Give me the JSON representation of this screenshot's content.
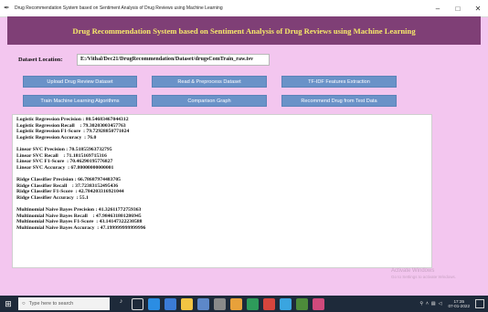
{
  "window": {
    "title": "Drug Recommendation System based on Sentiment Analysis of Drug Reviews using Machine Learning",
    "controls": {
      "minimize": "–",
      "maximize": "□",
      "close": "✕"
    }
  },
  "header": {
    "title": "Drug Recommendation System based on Sentiment Analysis of Drug Reviews using Machine Learning"
  },
  "dataset": {
    "label": "Dataset Location:",
    "path": "E:/Vithal/Dec21/DrugRecommendation/Dataset/drugsComTrain_raw.tsv"
  },
  "buttons": {
    "upload": "Upload Drug Review Dataset",
    "preprocess": "Read & Preprocess Dataset",
    "tfidf": "TF-IDF Features Extraction",
    "train": "Train Machine Learning Algorithms",
    "compare": "Comparison Graph",
    "recommend": "Recommend Drug from Test Data"
  },
  "results": {
    "lines": [
      "Logistic Regression Precision : 80.54683467044312",
      "Logistic Regression Recall    : 79.30203003457763",
      "Logistic Regression F1-Score  : 79.72928850771024",
      "Logistic Regression Accuracy  : 76.0",
      "",
      "Linear SVC Precision : 70.51855963732795",
      "Linear SVC Recall    : 71.1815169715316",
      "Linear SVC F1-Score  : 70.46290195776827",
      "Linear SVC Accuracy  : 67.80000000000001",
      "",
      "Ridge Classifier Precision : 66.7868797448370​5",
      "Ridge Classifier Recall    : 37.72383152495436",
      "Ridge Classifier F1-Score  : 42.78420331692104​4",
      "Ridge Classifier Accuracy  : 55.1",
      "",
      "Multinomial Naive Bayes Precision : 41.32611772759363",
      "Multinomial Naive Bayes Recall    : 47.984631801286945",
      "Multinomial Naive Bayes F1-Score  : 43.14147322230588",
      "Multinomial Naive Bayes Accuracy  : 47.199999999999996"
    ]
  },
  "watermark": {
    "line1": "Activate Windows",
    "line2": "Go to Settings to activate Windows."
  },
  "taskbar": {
    "search_placeholder": "Type here to search",
    "time": "17:35",
    "date": "07-01-2022",
    "icon_colors": [
      "#1f6fd0",
      "#2b8de3",
      "#f2c443",
      "#3b7bd6",
      "#e8a13a",
      "#5d88c9",
      "#2e9b5b",
      "#d6453d",
      "#e39a2b",
      "#3aa5e0",
      "#4d8b3a",
      "#d04a7c"
    ]
  }
}
